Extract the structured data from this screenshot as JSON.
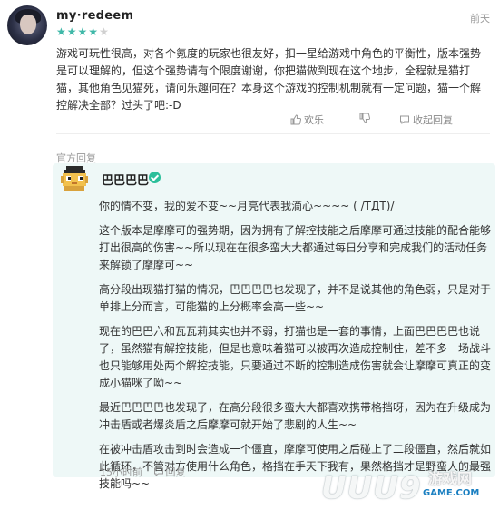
{
  "review": {
    "username": "my·redeem",
    "rating": 4,
    "rating_max": 5,
    "time": "前天",
    "text": "游戏可玩性很高，对各个氪度的玩家也很友好，扣一星给游戏中角色的平衡性，版本强势是可以理解的，但这个强势请有个限度谢谢，你把猫做到现在这个地步，全程就是猫打猫，其他角色见猫死，请问乐趣何在？本身这个游戏的控制机制就有一定问题，猫一个解控解决全部？过头了吧:-D",
    "actions": {
      "like_label": "欢乐",
      "dislike_label": "",
      "collapse_label": "收起回复"
    }
  },
  "official_reply": {
    "section_label": "官方回复",
    "developer_name": "巴巴巴巴",
    "paragraphs": [
      "你的情不变，我的爱不变~~月亮代表我滴心~~~~ ( /TДT)/",
      "这个版本是摩摩可的强势期，因为拥有了解控技能之后摩摩可通过技能的配合能够打出很高的伤害~~所以现在在很多蛮大大都通过每日分享和完成我们的活动任务来解锁了摩摩可~~",
      "高分段出现猫打猫的情况，巴巴巴巴也发现了，并不是说其他的角色弱，只是对于单排上分而言，可能猫的上分概率会高一些~~",
      "现在的巴巴六和瓦瓦莉其实也并不弱，打猫也是一套的事情，上面巴巴巴巴也说了，虽然猫有解控技能，但是也意味着猫可以被再次造成控制住，差不多一场战斗也只能够用处两个解控技能，只要通过不断的控制造成伤害就会让摩摩可真正的变成小猫咪了呦~~",
      "最近巴巴巴巴也发现了，在高分段很多蛮大大都喜欢携带格挡呀，因为在升级成为冲击盾或者爆炎盾之后摩摩可就开始了悲剧的人生~~",
      "在被冲击盾攻击到时会造成一个僵直，摩摩可使用之后碰上了二段僵直，然后就如此循环，不管对方使用什么角色，格挡在手天下我有，果然格挡才是野蛮人的最强技能吗~~"
    ],
    "time": "15小时前",
    "reply_label": "回复"
  },
  "watermark": {
    "logo": "UUU9",
    "cn": "游戏网",
    "url": "GAME.COM"
  },
  "colors": {
    "accent": "#3fb8a8",
    "reply_bg": "#eef8f7",
    "verified": "#2bbf9a"
  }
}
